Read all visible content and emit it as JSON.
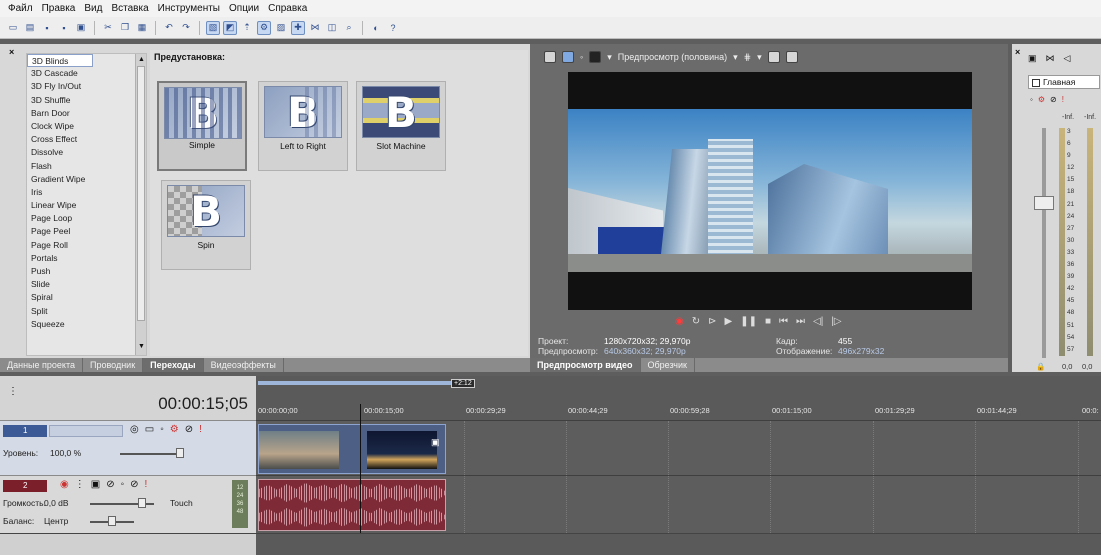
{
  "menu": [
    "Файл",
    "Правка",
    "Вид",
    "Вставка",
    "Инструменты",
    "Опции",
    "Справка"
  ],
  "transitions_list": [
    "3D Blinds",
    "3D Cascade",
    "3D Fly In/Out",
    "3D Shuffle",
    "Barn Door",
    "Clock Wipe",
    "Cross Effect",
    "Dissolve",
    "Flash",
    "Gradient Wipe",
    "Iris",
    "Linear Wipe",
    "Page Loop",
    "Page Peel",
    "Page Roll",
    "Portals",
    "Push",
    "Slide",
    "Spiral",
    "Split",
    "Squeeze"
  ],
  "presets": {
    "title": "Предустановка:",
    "items": [
      {
        "label": "Simple"
      },
      {
        "label": "Left to Right"
      },
      {
        "label": "Slot Machine"
      },
      {
        "label": "Spin"
      }
    ],
    "glyph": "B"
  },
  "left_tabs": [
    "Данные проекта",
    "Проводник",
    "Переходы",
    "Видеоэффекты"
  ],
  "preview": {
    "mode_label": "Предпросмотр (половина)",
    "info": {
      "project_label": "Проект:",
      "project_value": "1280x720x32; 29,970p",
      "preview_label": "Предпросмотр:",
      "preview_value": "640x360x32; 29,970p",
      "frame_label": "Кадр:",
      "frame_value": "455",
      "display_label": "Отображение:",
      "display_value": "496x279x32"
    },
    "tabs": [
      "Предпросмотр видео",
      "Обрезчик"
    ]
  },
  "mixer": {
    "main_label": "Главная",
    "inf_left": "-Inf.",
    "inf_right": "-Inf.",
    "scale": [
      "3",
      "6",
      "9",
      "12",
      "15",
      "18",
      "21",
      "24",
      "27",
      "30",
      "33",
      "36",
      "39",
      "42",
      "45",
      "48",
      "51",
      "54",
      "57"
    ],
    "foot_left": "0,0",
    "foot_right": "0,0"
  },
  "timeline": {
    "timecode": "00:00:15;05",
    "marker": "+2:12",
    "ruler_ticks": [
      "00:00:00;00",
      "00:00:15;00",
      "00:00:29;29",
      "00:00:44;29",
      "00:00:59;28",
      "00:01:15;00",
      "00:01:29;29",
      "00:01:44;29",
      "00:0:"
    ],
    "video_track": {
      "number": "1",
      "level_label": "Уровень:",
      "level_value": "100,0 %"
    },
    "audio_track": {
      "number": "2",
      "volume_label": "Громкость:",
      "volume_value": "0,0 dB",
      "pan_label": "Баланс:",
      "pan_value": "Центр",
      "automation_mode": "Touch",
      "vu_scale": [
        "12",
        "24",
        "36",
        "48"
      ]
    }
  }
}
